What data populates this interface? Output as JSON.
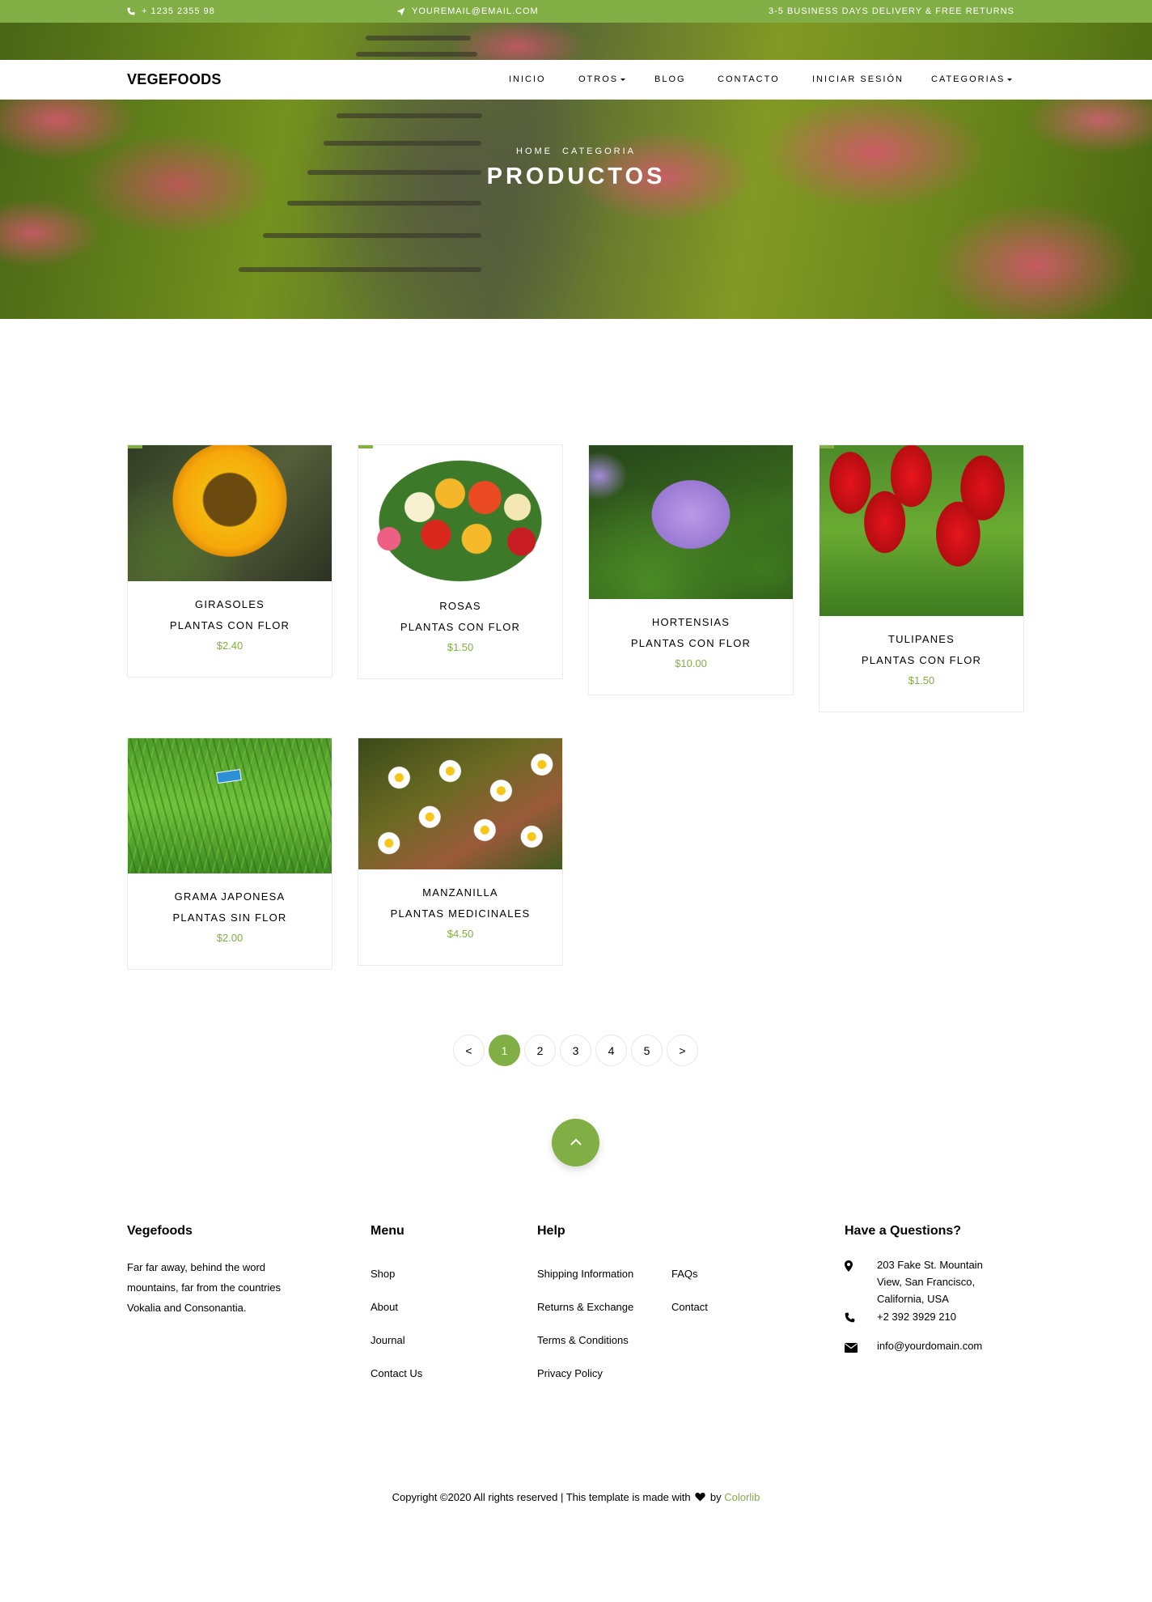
{
  "topbar": {
    "phone": "+ 1235 2355 98",
    "email": "YOUREMAIL@EMAIL.COM",
    "delivery": "3-5 BUSINESS DAYS DELIVERY & FREE RETURNS"
  },
  "navbar": {
    "brand": "VEGEFOODS",
    "items": [
      "INICIO",
      "OTROS",
      "BLOG",
      "CONTACTO",
      "INICIAR SESIÓN",
      "CATEGORIAS"
    ]
  },
  "hero": {
    "breadcrumb": [
      "HOME",
      "CATEGORIA"
    ],
    "title": "PRODUCTOS"
  },
  "products": [
    {
      "name": "GIRASOLES",
      "category": "PLANTAS CON FLOR",
      "price": "$2.40"
    },
    {
      "name": "ROSAS",
      "category": "PLANTAS CON FLOR",
      "price": "$1.50"
    },
    {
      "name": "HORTENSIAS",
      "category": "PLANTAS CON FLOR",
      "price": "$10.00"
    },
    {
      "name": "TULIPANES",
      "category": "PLANTAS CON FLOR",
      "price": "$1.50"
    },
    {
      "name": "GRAMA JAPONESA",
      "category": "PLANTAS SIN FLOR",
      "price": "$2.00"
    },
    {
      "name": "MANZANILLA",
      "category": "PLANTAS MEDICINALES",
      "price": "$4.50"
    }
  ],
  "pagination": {
    "prev": "<",
    "pages": [
      "1",
      "2",
      "3",
      "4",
      "5"
    ],
    "next": ">",
    "current": "1"
  },
  "footer": {
    "about": {
      "title": "Vegefoods",
      "text": "Far far away, behind the word mountains, far from the countries Vokalia and Consonantia."
    },
    "menu": {
      "title": "Menu",
      "links": [
        "Shop",
        "About",
        "Journal",
        "Contact Us"
      ]
    },
    "help": {
      "title": "Help",
      "links_left": [
        "Shipping Information",
        "Returns & Exchange",
        "Terms & Conditions",
        "Privacy Policy"
      ],
      "links_right": [
        "FAQs",
        "Contact"
      ]
    },
    "contact": {
      "title": "Have a Questions?",
      "address": "203 Fake St. Mountain View, San Francisco, California, USA",
      "phone": "+2 392 3929 210",
      "email": "info@yourdomain.com"
    },
    "copyright": {
      "before": "Copyright ©2020 All rights reserved | This template is made with",
      "by": "by",
      "link": "Colorlib"
    }
  },
  "colors": {
    "accent": "#82ae46"
  }
}
